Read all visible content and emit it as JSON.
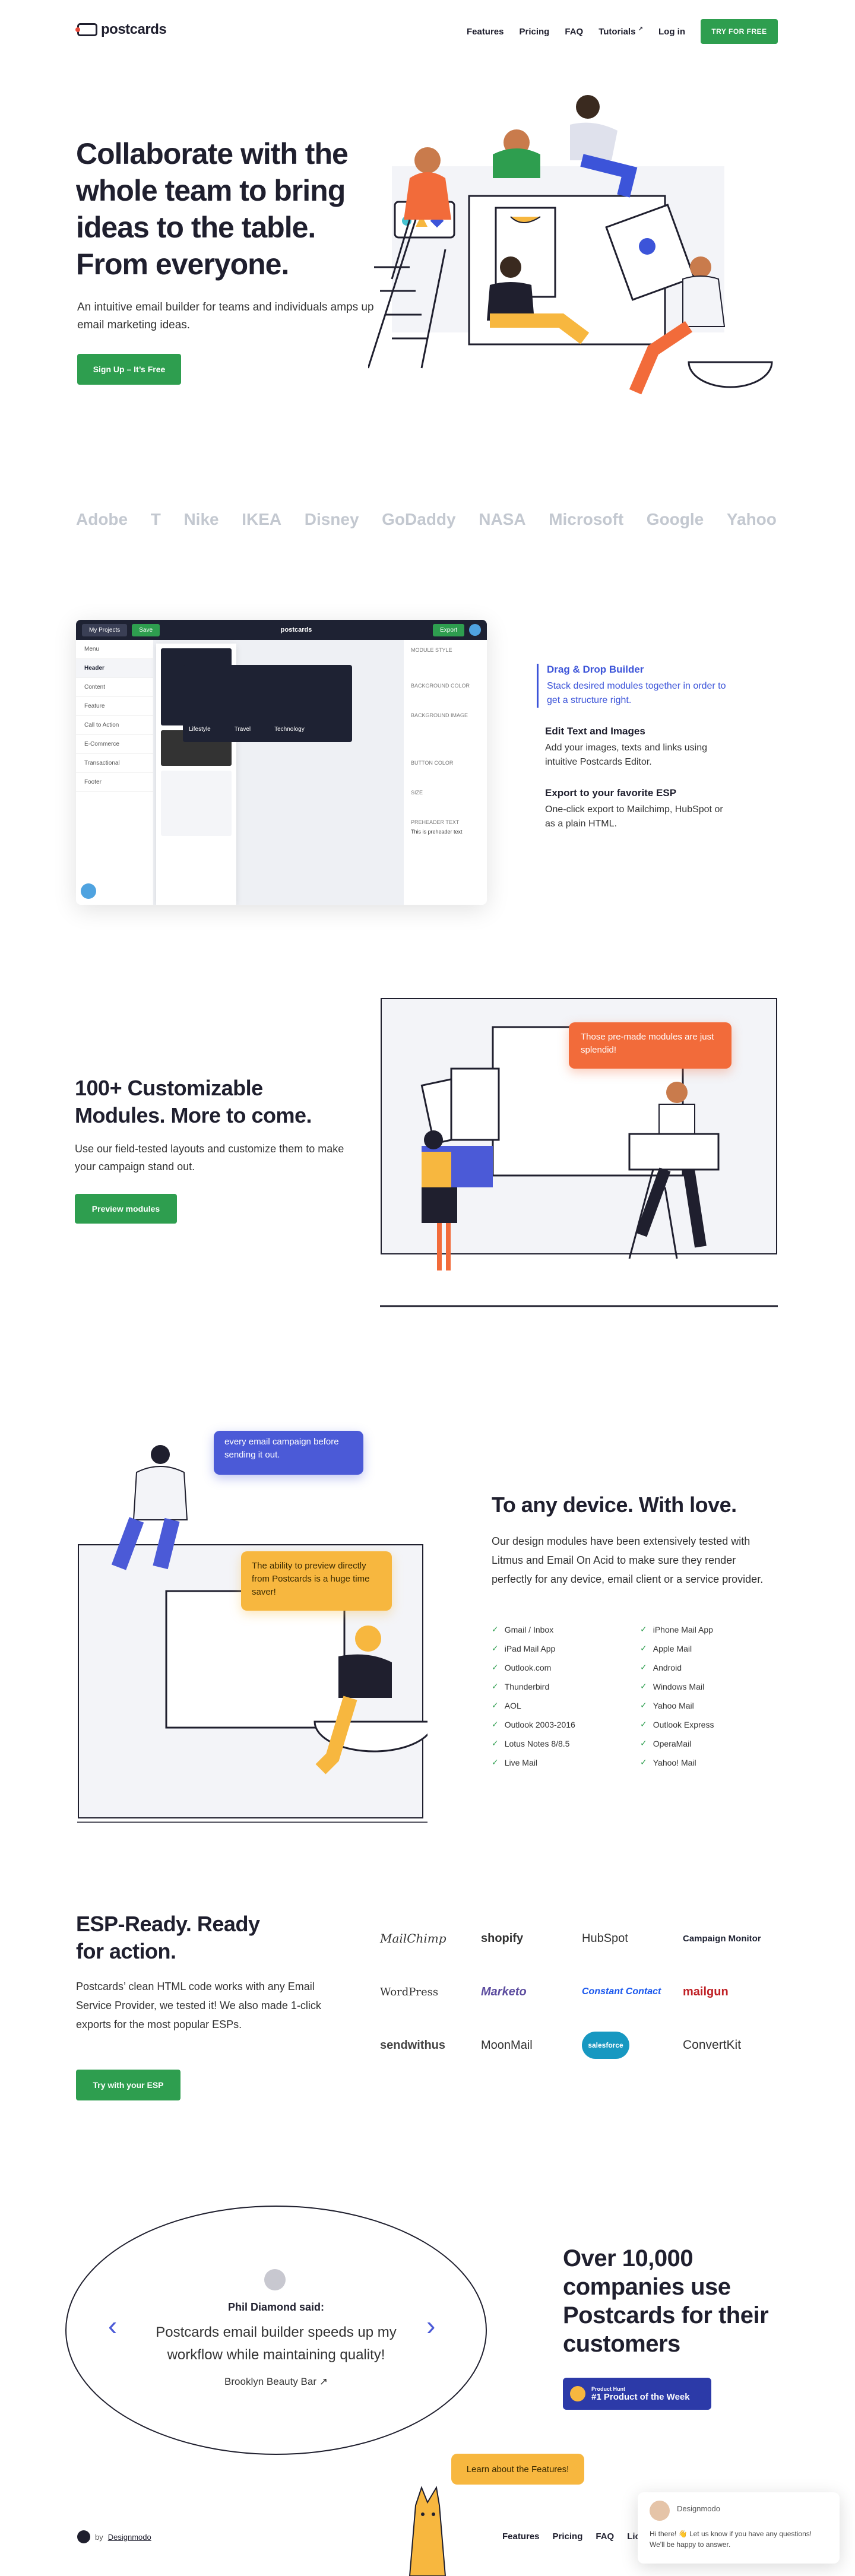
{
  "nav": {
    "logo": "postcards",
    "links": [
      "Features",
      "Pricing",
      "FAQ",
      "Tutorials",
      "Log in"
    ],
    "tutorials_badge": "↗",
    "cta": "TRY FOR FREE"
  },
  "hero": {
    "title": "Collaborate with the whole team to bring ideas to the table. From everyone.",
    "subtitle": "An intuitive email builder for teams and individuals amps up email marketing ideas.",
    "cta": "Sign Up – It’s Free"
  },
  "logos": [
    "Adobe",
    "T",
    "Nike",
    "IKEA",
    "Disney",
    "GoDaddy",
    "NASA",
    "Microsoft",
    "Google",
    "Yahoo"
  ],
  "builder": {
    "top_left": "My Projects",
    "top_save": "Save",
    "top_logo": "postcards",
    "top_export": "Export",
    "sidebar": [
      "Menu",
      "Header",
      "Content",
      "Feature",
      "Call to Action",
      "E-Commerce",
      "Transactional",
      "Footer"
    ],
    "canvas_tabs": [
      "Lifestyle",
      "Travel",
      "Technology"
    ],
    "right_labels": [
      "MODULE STYLE",
      "BACKGROUND COLOR",
      "BACKGROUND IMAGE",
      "BUTTON COLOR",
      "SIZE",
      "PREHEADER TEXT"
    ],
    "right_preheader": "This is preheader text"
  },
  "features": [
    {
      "title": "Drag & Drop Builder",
      "desc": "Stack desired modules together in order to get a structure right."
    },
    {
      "title": "Edit Text and Images",
      "desc": "Add your images, texts and links using intuitive Postcards Editor."
    },
    {
      "title": "Export to your favorite ESP",
      "desc": "One-click export to Mailchimp, HubSpot or as a plain HTML."
    }
  ],
  "modules": {
    "title": "100+ Customizable Modules. More to come.",
    "subtitle": "Use our field-tested layouts and customize them to make your campaign stand out.",
    "cta": "Preview modules",
    "bubble": "Those pre-made modules are just splendid!"
  },
  "device": {
    "bubble_top": "every email campaign before sending it out.",
    "bubble_bottom": "The ability to preview directly from Postcards is a huge time saver!",
    "title": "To any device. With love.",
    "subtitle": "Our design modules have been extensively tested with Litmus and Email On Acid to make sure they render perfectly for any device, email client or a service provider.",
    "clients": [
      "Gmail / Inbox",
      "iPhone Mail App",
      "iPad Mail App",
      "Apple Mail",
      "Outlook.com",
      "Android",
      "Thunderbird",
      "Windows Mail",
      "AOL",
      "Yahoo Mail",
      "Outlook 2003-2016",
      "Outlook Express",
      "Lotus Notes 8/8.5",
      "OperaMail",
      "Live Mail",
      "Yahoo! Mail"
    ]
  },
  "esp": {
    "title": "ESP-Ready. Ready for action.",
    "subtitle": "Postcards’ clean HTML code works with any Email Service Provider, we tested it! We also made 1-click exports for the most popular ESPs.",
    "cta": "Try with your ESP",
    "providers": [
      "MailChimp",
      "shopify",
      "HubSpot",
      "Campaign Monitor",
      "WordPress",
      "Marketo",
      "Constant Contact",
      "mailgun",
      "sendwithus",
      "MoonMail",
      "salesforce",
      "ConvertKit"
    ]
  },
  "testimonial": {
    "name": "Phil Diamond said:",
    "quote": "Postcards email builder speeds up my workflow while maintaining quality!",
    "company": "Brooklyn Beauty Bar ↗",
    "prev": "‹",
    "next": "›"
  },
  "social_proof": {
    "title": "Over 10,000 companies use Postcards for their customers",
    "badge_small": "Product Hunt",
    "badge_big": "#1 Product of the Week"
  },
  "footer": {
    "learn": "Learn about the Features!",
    "by": "by",
    "by_brand": "Designmodo",
    "links": [
      "Features",
      "Pricing",
      "FAQ",
      "Lice"
    ]
  },
  "chat": {
    "name": "Designmodo",
    "message": "Hi there! 👋 Let us know if you have any questions! We'll be happy to answer."
  },
  "colors": {
    "green": "#2e9e4f",
    "blue": "#3c54d9",
    "orange": "#f26b3a",
    "yellow": "#f7b73f",
    "dark": "#1e2233"
  }
}
